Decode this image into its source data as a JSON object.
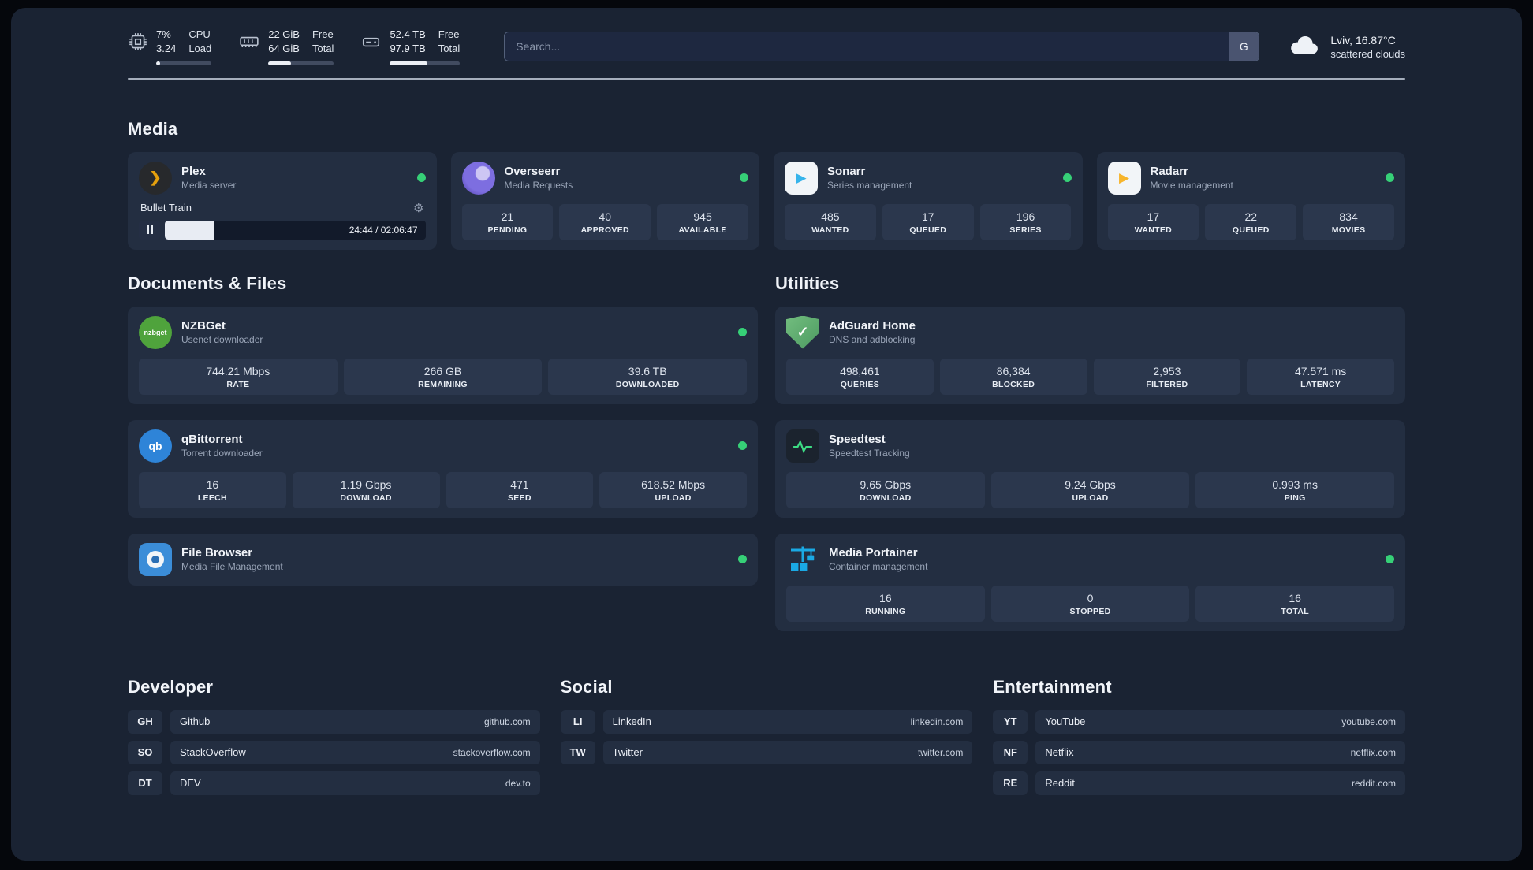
{
  "topbar": {
    "cpu": {
      "value1": "7%",
      "value2": "3.24",
      "label1": "CPU",
      "label2": "Load",
      "bar_percent": 7
    },
    "ram": {
      "value1": "22 GiB",
      "value2": "64 GiB",
      "label1": "Free",
      "label2": "Total",
      "bar_percent": 34
    },
    "disk": {
      "value1": "52.4 TB",
      "value2": "97.9 TB",
      "label1": "Free",
      "label2": "Total",
      "bar_percent": 54
    },
    "search": {
      "placeholder": "Search...",
      "button_label": "G"
    },
    "weather": {
      "location": "Lviv, 16.87°C",
      "condition": "scattered clouds"
    }
  },
  "sections": {
    "media": "Media",
    "documents": "Documents & Files",
    "utilities": "Utilities"
  },
  "media_apps": [
    {
      "name": "Plex",
      "subtitle": "Media server",
      "online": true,
      "player": {
        "title": "Bullet Train",
        "time": "24:44 / 02:06:47",
        "progress_percent": 19
      }
    },
    {
      "name": "Overseerr",
      "subtitle": "Media Requests",
      "online": true,
      "stats": [
        {
          "value": "21",
          "label": "PENDING"
        },
        {
          "value": "40",
          "label": "APPROVED"
        },
        {
          "value": "945",
          "label": "AVAILABLE"
        }
      ]
    },
    {
      "name": "Sonarr",
      "subtitle": "Series management",
      "online": true,
      "stats": [
        {
          "value": "485",
          "label": "WANTED"
        },
        {
          "value": "17",
          "label": "QUEUED"
        },
        {
          "value": "196",
          "label": "SERIES"
        }
      ]
    },
    {
      "name": "Radarr",
      "subtitle": "Movie management",
      "online": true,
      "stats": [
        {
          "value": "17",
          "label": "WANTED"
        },
        {
          "value": "22",
          "label": "QUEUED"
        },
        {
          "value": "834",
          "label": "MOVIES"
        }
      ]
    }
  ],
  "documents_apps": [
    {
      "name": "NZBGet",
      "subtitle": "Usenet downloader",
      "online": true,
      "stats": [
        {
          "value": "744.21 Mbps",
          "label": "RATE"
        },
        {
          "value": "266 GB",
          "label": "REMAINING"
        },
        {
          "value": "39.6 TB",
          "label": "DOWNLOADED"
        }
      ]
    },
    {
      "name": "qBittorrent",
      "subtitle": "Torrent downloader",
      "online": true,
      "stats": [
        {
          "value": "16",
          "label": "LEECH"
        },
        {
          "value": "1.19 Gbps",
          "label": "DOWNLOAD"
        },
        {
          "value": "471",
          "label": "SEED"
        },
        {
          "value": "618.52 Mbps",
          "label": "UPLOAD"
        }
      ]
    },
    {
      "name": "File Browser",
      "subtitle": "Media File Management",
      "online": true
    }
  ],
  "utilities_apps": [
    {
      "name": "AdGuard Home",
      "subtitle": "DNS and adblocking",
      "stats": [
        {
          "value": "498,461",
          "label": "QUERIES"
        },
        {
          "value": "86,384",
          "label": "BLOCKED"
        },
        {
          "value": "2,953",
          "label": "FILTERED"
        },
        {
          "value": "47.571 ms",
          "label": "LATENCY"
        }
      ]
    },
    {
      "name": "Speedtest",
      "subtitle": "Speedtest Tracking",
      "stats": [
        {
          "value": "9.65 Gbps",
          "label": "DOWNLOAD"
        },
        {
          "value": "9.24 Gbps",
          "label": "UPLOAD"
        },
        {
          "value": "0.993 ms",
          "label": "PING"
        }
      ]
    },
    {
      "name": "Media Portainer",
      "subtitle": "Container management",
      "online": true,
      "stats": [
        {
          "value": "16",
          "label": "RUNNING"
        },
        {
          "value": "0",
          "label": "STOPPED"
        },
        {
          "value": "16",
          "label": "TOTAL"
        }
      ]
    }
  ],
  "link_sections": [
    {
      "title": "Developer",
      "links": [
        {
          "abbr": "GH",
          "name": "Github",
          "url": "github.com"
        },
        {
          "abbr": "SO",
          "name": "StackOverflow",
          "url": "stackoverflow.com"
        },
        {
          "abbr": "DT",
          "name": "DEV",
          "url": "dev.to"
        }
      ]
    },
    {
      "title": "Social",
      "links": [
        {
          "abbr": "LI",
          "name": "LinkedIn",
          "url": "linkedin.com"
        },
        {
          "abbr": "TW",
          "name": "Twitter",
          "url": "twitter.com"
        }
      ]
    },
    {
      "title": "Entertainment",
      "links": [
        {
          "abbr": "YT",
          "name": "YouTube",
          "url": "youtube.com"
        },
        {
          "abbr": "NF",
          "name": "Netflix",
          "url": "netflix.com"
        },
        {
          "abbr": "RE",
          "name": "Reddit",
          "url": "reddit.com"
        }
      ]
    }
  ],
  "icons": {
    "plex": "❯",
    "sonarr": "▶",
    "radarr": "▶",
    "qbittorrent": "qb",
    "nzbget": "nzbget",
    "adguard_check": "✓",
    "gear": "⚙"
  },
  "colors": {
    "status_online": "#36d077",
    "plex_accent": "#e5a00d",
    "sonarr_accent": "#36b4eb",
    "radarr_accent": "#f7b52c",
    "adguard_green": "#5fae6f",
    "speedtest_green": "#3ddc84",
    "portainer_blue": "#1aa9e4",
    "qbittorrent_blue": "#2e84d8",
    "nzbget_green": "#4fa33c",
    "overseerr_purple": "#7d6ee0",
    "panel_bg": "#1a2333",
    "card_bg": "#232e41",
    "stat_bg": "#2b374d"
  }
}
